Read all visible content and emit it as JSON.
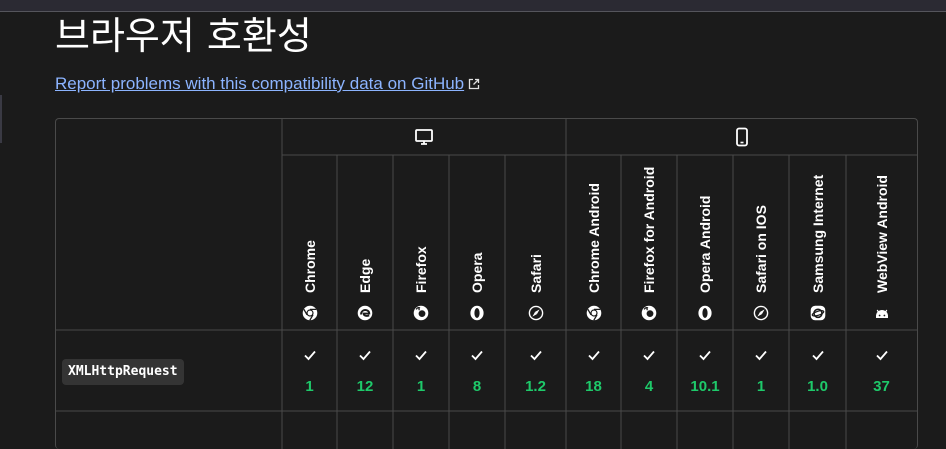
{
  "page": {
    "heading": "브라우저 호환성",
    "report_link": "Report problems with this compatibility data on GitHub"
  },
  "platforms": [
    {
      "name": "desktop",
      "icon": "desktop-icon"
    },
    {
      "name": "mobile",
      "icon": "mobile-icon"
    }
  ],
  "browsers": [
    {
      "name": "Chrome",
      "icon": "chrome-icon",
      "platform": "desktop"
    },
    {
      "name": "Edge",
      "icon": "edge-icon",
      "platform": "desktop"
    },
    {
      "name": "Firefox",
      "icon": "firefox-icon",
      "platform": "desktop"
    },
    {
      "name": "Opera",
      "icon": "opera-icon",
      "platform": "desktop"
    },
    {
      "name": "Safari",
      "icon": "safari-icon",
      "platform": "desktop"
    },
    {
      "name": "Chrome Android",
      "icon": "chrome-icon",
      "platform": "mobile"
    },
    {
      "name": "Firefox for Android",
      "icon": "firefox-icon",
      "platform": "mobile"
    },
    {
      "name": "Opera Android",
      "icon": "opera-icon",
      "platform": "mobile"
    },
    {
      "name": "Safari on IOS",
      "icon": "safari-icon",
      "platform": "mobile"
    },
    {
      "name": "Samsung Internet",
      "icon": "samsung-internet-icon",
      "platform": "mobile"
    },
    {
      "name": "WebView Android",
      "icon": "android-icon",
      "platform": "mobile"
    }
  ],
  "features": [
    {
      "name": "XMLHttpRequest",
      "support": [
        "1",
        "12",
        "1",
        "8",
        "1.2",
        "18",
        "4",
        "10.1",
        "1",
        "1.0",
        "37"
      ]
    }
  ],
  "colors": {
    "supported": "#1ec96a",
    "link": "#8cb4ff",
    "background": "#1b1b1b",
    "border": "#4a4a4a"
  }
}
